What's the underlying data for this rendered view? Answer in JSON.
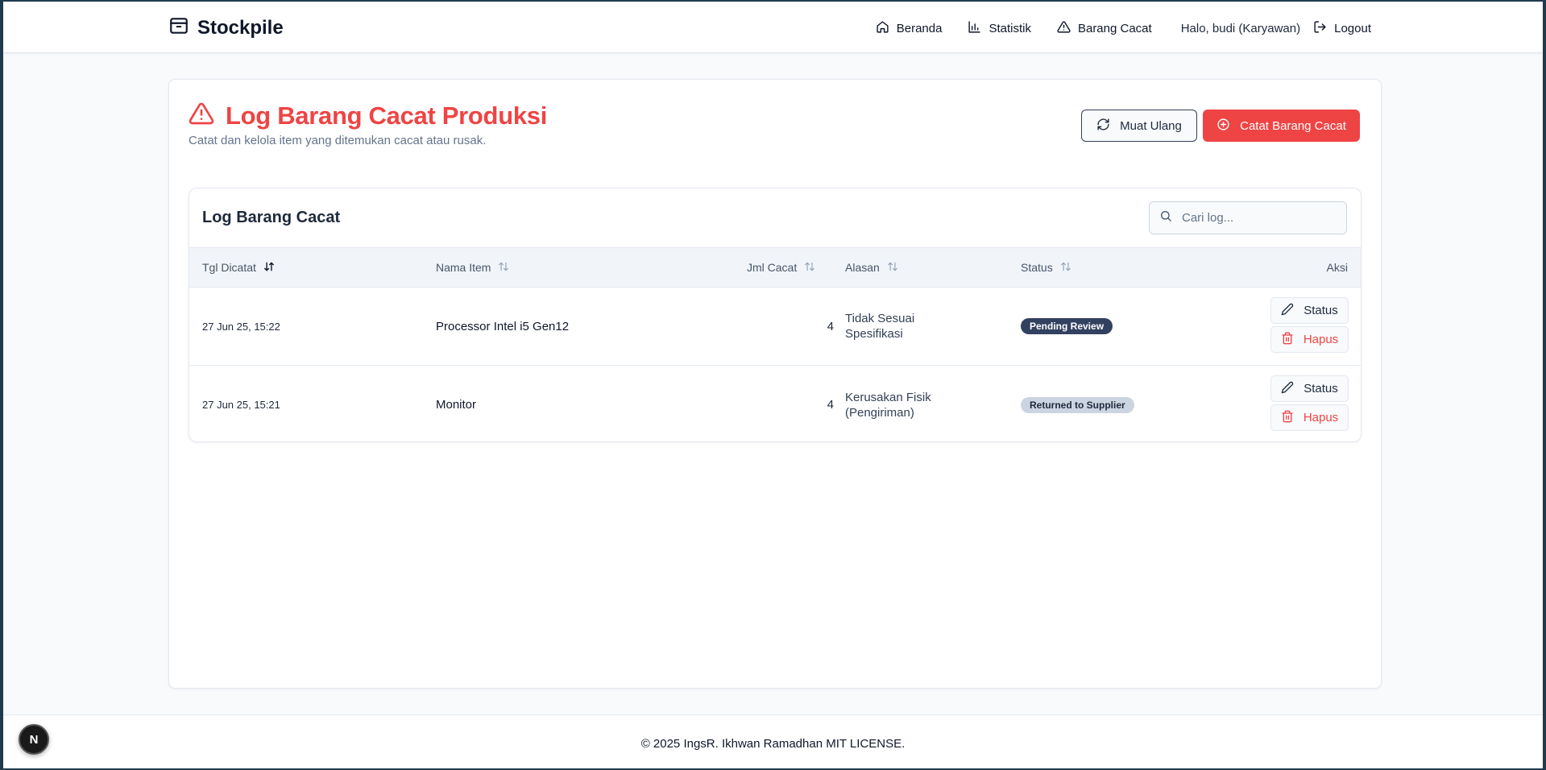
{
  "app": {
    "brand": "Stockpile",
    "brand_icon": "store-icon"
  },
  "nav": {
    "items": [
      {
        "label": "Beranda",
        "icon": "home-icon"
      },
      {
        "label": "Statistik",
        "icon": "bar-chart-icon"
      },
      {
        "label": "Barang Cacat",
        "icon": "alert-triangle-icon"
      }
    ],
    "greeting": "Halo, budi (Karyawan)",
    "logout": "Logout"
  },
  "page": {
    "title": "Log Barang Cacat Produksi",
    "subtitle": "Catat dan kelola item yang ditemukan cacat atau rusak.",
    "reload_label": "Muat Ulang",
    "add_label": "Catat Barang Cacat",
    "accent": "#ef4444"
  },
  "table": {
    "title": "Log Barang Cacat",
    "search_placeholder": "Cari log...",
    "columns": {
      "date": "Tgl Dicatat",
      "name": "Nama Item",
      "qty": "Jml Cacat",
      "reason": "Alasan",
      "status": "Status",
      "action": "Aksi"
    },
    "rows": [
      {
        "date": "27 Jun 25, 15:22",
        "name": "Processor Intel i5 Gen12",
        "qty": "4",
        "reason": "Tidak Sesuai Spesifikasi",
        "status": "Pending Review",
        "status_color": "#334160"
      },
      {
        "date": "27 Jun 25, 15:21",
        "name": "Monitor",
        "qty": "4",
        "reason": "Kerusakan Fisik (Pengiriman)",
        "status": "Returned to Supplier",
        "status_color": "#cbd5e1"
      }
    ],
    "action_status": "Status",
    "action_delete": "Hapus"
  },
  "footer": {
    "text": "© 2025 IngsR. Ikhwan Ramadhan MIT LICENSE."
  },
  "dev_badge": {
    "letter": "N"
  }
}
